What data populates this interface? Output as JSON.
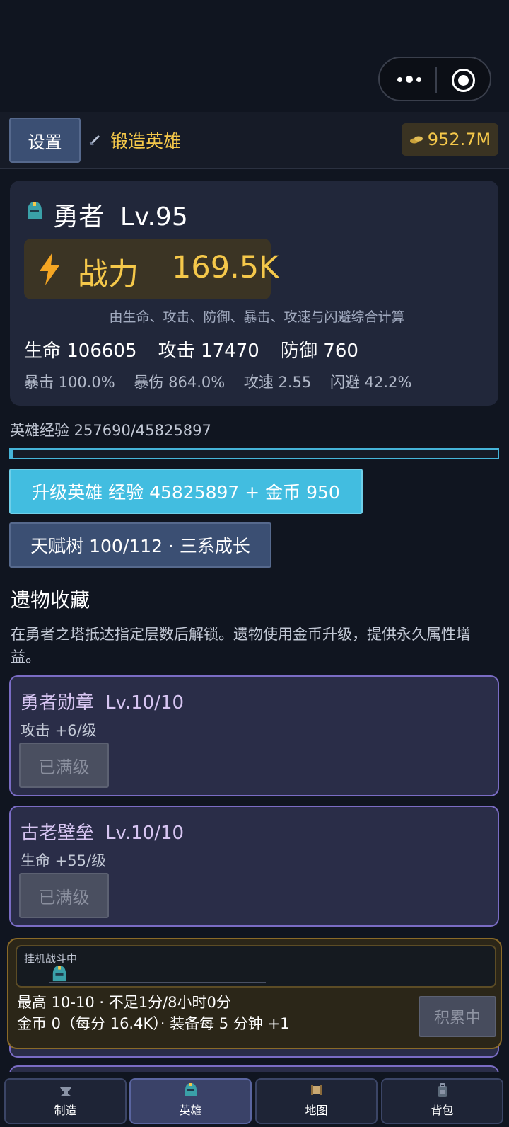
{
  "header": {
    "settings_label": "设置",
    "title": "锻造英雄",
    "gold": "952.7M"
  },
  "hero": {
    "name": "勇者",
    "level": "Lv.95",
    "power_label": "战力",
    "power_value": "169.5K",
    "power_note": "由生命、攻击、防御、暴击、攻速与闪避综合计算",
    "stats": [
      {
        "text": "生命 106605"
      },
      {
        "text": "攻击 17470"
      },
      {
        "text": "防御 760"
      }
    ],
    "sub_stats": [
      {
        "text": "暴击 100.0%"
      },
      {
        "text": "暴伤 864.0%"
      },
      {
        "text": "攻速 2.55"
      },
      {
        "text": "闪避 42.2%"
      }
    ]
  },
  "experience": {
    "label": "英雄经验 257690/45825897",
    "progress_fraction": 0.0056
  },
  "actions": {
    "upgrade_label": "升级英雄  经验 45825897 + 金币 950",
    "talent_label": "天赋树  100/112 · 三系成长"
  },
  "relics": {
    "title": "遗物收藏",
    "description": "在勇者之塔抵达指定层数后解锁。遗物使用金币升级，提供永久属性增益。",
    "items": [
      {
        "name": "勇者勋章",
        "level": "Lv.10/10",
        "effect": "攻击 +6/级",
        "button": "已满级"
      },
      {
        "name": "古老壁垒",
        "level": "Lv.10/10",
        "effect": "生命 +55/级",
        "button": "已满级"
      }
    ]
  },
  "idle": {
    "status_label": "挂机战斗中",
    "line1": "最高 10-10 · 不足1分/8小时0分",
    "line2": "金币 0（每分 16.4K）· 装备每 5 分钟 +1",
    "button": "积累中"
  },
  "nav": {
    "tabs": [
      {
        "label": "制造",
        "icon": "anvil-icon"
      },
      {
        "label": "英雄",
        "icon": "knight-helmet-icon"
      },
      {
        "label": "地图",
        "icon": "scroll-map-icon"
      },
      {
        "label": "背包",
        "icon": "backpack-icon"
      }
    ],
    "active": "英雄"
  },
  "colors": {
    "gold": "#f5c84a",
    "accent_blue": "#42bde0",
    "relic_border": "#7a6cc4",
    "idle_border": "#8a6a28"
  }
}
